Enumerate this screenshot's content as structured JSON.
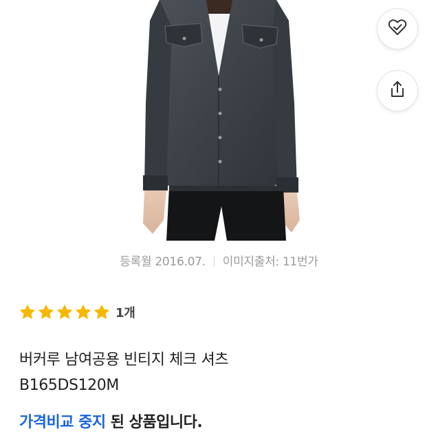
{
  "product": {
    "image_alt_icon": "product-photo",
    "meta": {
      "registered": "등록월 2016.07.",
      "source": "이미지출처: 11번가"
    },
    "rating": {
      "stars": 5,
      "count": "1개",
      "star_color": "#f5b800"
    },
    "title_line1": "버커루 남여공용 빈티지 체크 셔츠",
    "title_line2": "B165DS120M",
    "notice_highlight": "가격비교 중지",
    "notice_rest": "된 상품입니다.",
    "accent_color": "#1a64e0"
  },
  "actions": {
    "wishlist_icon": "heart-check-icon",
    "share_icon": "share-icon"
  }
}
